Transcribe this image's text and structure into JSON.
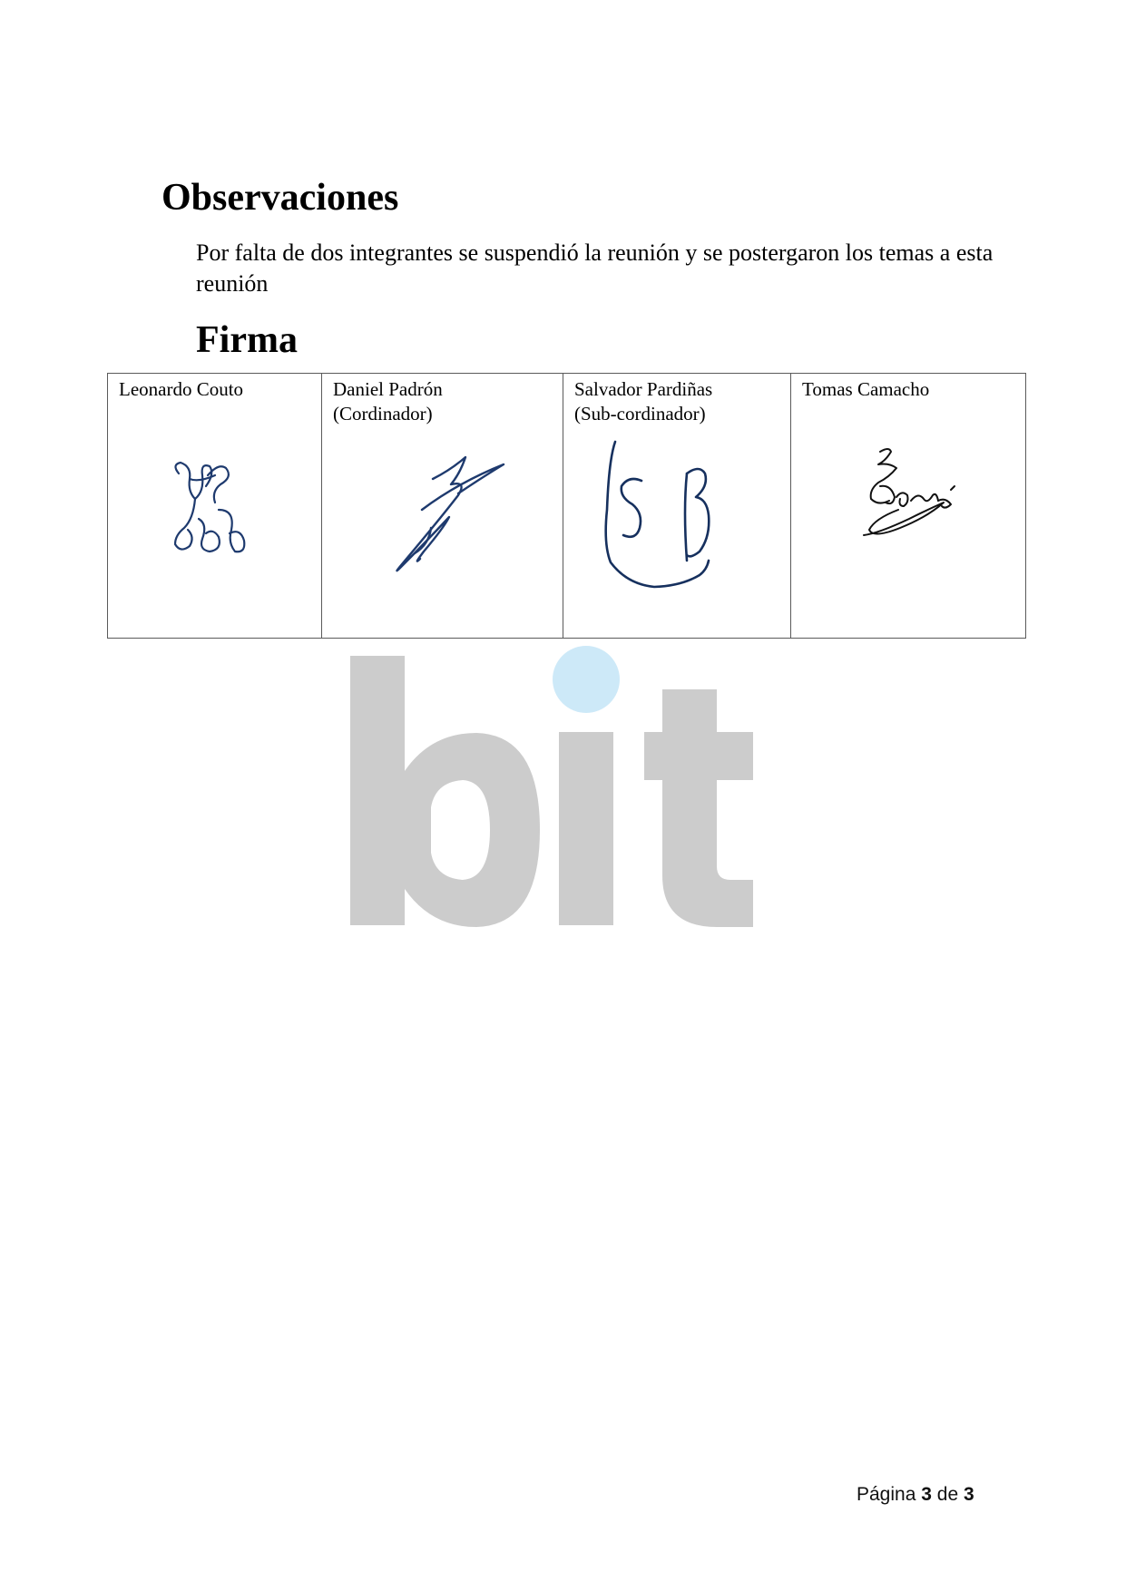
{
  "watermark": {
    "text": "bit",
    "letter_color": "#cccccc",
    "dot_color": "#cde9f8"
  },
  "observaciones": {
    "heading": "Observaciones",
    "text": "Por falta de dos integrantes se suspendió la reunión y se postergaron los temas a esta reunión"
  },
  "firma": {
    "heading": "Firma",
    "signers": [
      {
        "name": "Leonardo Couto",
        "role": "",
        "ink": "#1e3a6e"
      },
      {
        "name": "Daniel Padrón",
        "role": "(Cordinador)",
        "ink": "#1e3a6e"
      },
      {
        "name": "Salvador Pardiñas",
        "role": "(Sub-cordinador)",
        "ink": "#16305e"
      },
      {
        "name": "Tomas Camacho",
        "role": "",
        "ink": "#111111"
      }
    ]
  },
  "footer": {
    "page_label": "Página",
    "current": "3",
    "separator": "de",
    "total": "3"
  }
}
